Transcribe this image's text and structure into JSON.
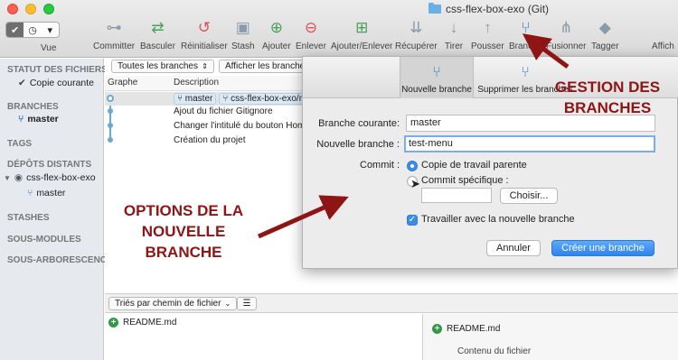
{
  "window": {
    "title": "css-flex-box-exo (Git)"
  },
  "toolbar": {
    "view_label": "Vue",
    "items": [
      {
        "label": "Committer",
        "icon": "commit-icon"
      },
      {
        "label": "Basculer",
        "icon": "checkout-icon"
      },
      {
        "label": "Réinitialiser",
        "icon": "reset-icon"
      },
      {
        "label": "Stash",
        "icon": "stash-icon"
      },
      {
        "label": "Ajouter",
        "icon": "add-icon"
      },
      {
        "label": "Enlever",
        "icon": "remove-icon"
      },
      {
        "label": "Ajouter/Enlever",
        "icon": "add-remove-icon"
      },
      {
        "label": "Récupérer",
        "icon": "fetch-icon"
      },
      {
        "label": "Tirer",
        "icon": "pull-icon"
      },
      {
        "label": "Pousser",
        "icon": "push-icon"
      },
      {
        "label": "Branche",
        "icon": "branch-icon"
      },
      {
        "label": "Fusionner",
        "icon": "merge-icon"
      },
      {
        "label": "Tagger",
        "icon": "tag-icon"
      },
      {
        "label": "Affich",
        "icon": ""
      }
    ]
  },
  "sidebar": {
    "file_status_heading": "STATUT DES FICHIERS",
    "working_copy": "Copie courante",
    "branches_heading": "BRANCHES",
    "branch_master": "master",
    "tags_heading": "TAGS",
    "remotes_heading": "DÉPÔTS DISTANTS",
    "remote_name": "css-flex-box-exo",
    "remote_branch": "master",
    "stashes_heading": "STASHES",
    "submodules_heading": "SOUS-MODULES",
    "subtrees_heading": "SOUS-ARBORESCENC..."
  },
  "history": {
    "filter_all": "Toutes les branches",
    "filter_show": "Afficher les branche",
    "col_graph": "Graphe",
    "col_description": "Description",
    "commits": [
      {
        "tag_local": "master",
        "tag_remote": "css-flex-box-exo/ma"
      },
      {
        "description": "Ajout du fichier Gitignore"
      },
      {
        "description": "Changer l'intitulé du bouton Hom"
      },
      {
        "description": "Création du projet"
      }
    ]
  },
  "files": {
    "sort_label": "Triés par chemin de fichier",
    "file_name": "README.md",
    "diff_file_name": "README.md",
    "diff_content_label": "Contenu du fichier"
  },
  "sheet": {
    "tab_new_branch": "Nouvelle branche",
    "tab_delete_branches": "Supprimer les branches",
    "current_branch_label": "Branche courante:",
    "current_branch_value": "master",
    "new_branch_label": "Nouvelle branche :",
    "new_branch_value": "test-menu",
    "commit_label": "Commit :",
    "option_working_copy": "Copie de travail parente",
    "option_specific_commit": "Commit spécifique :",
    "specific_commit_value": "",
    "choose_button": "Choisir...",
    "checkout_checkbox": "Travailler avec la nouvelle branche",
    "cancel_button": "Annuler",
    "create_button": "Créer une branche"
  },
  "annotations": {
    "branch_management_line1": "GESTION DES",
    "branch_management_line2": "BRANCHES",
    "options_line1": "OPTIONS DE LA",
    "options_line2": "NOUVELLE",
    "options_line3": "BRANCHE"
  },
  "colors": {
    "annotation": "#8f1414",
    "accent": "#3a8ee6"
  }
}
